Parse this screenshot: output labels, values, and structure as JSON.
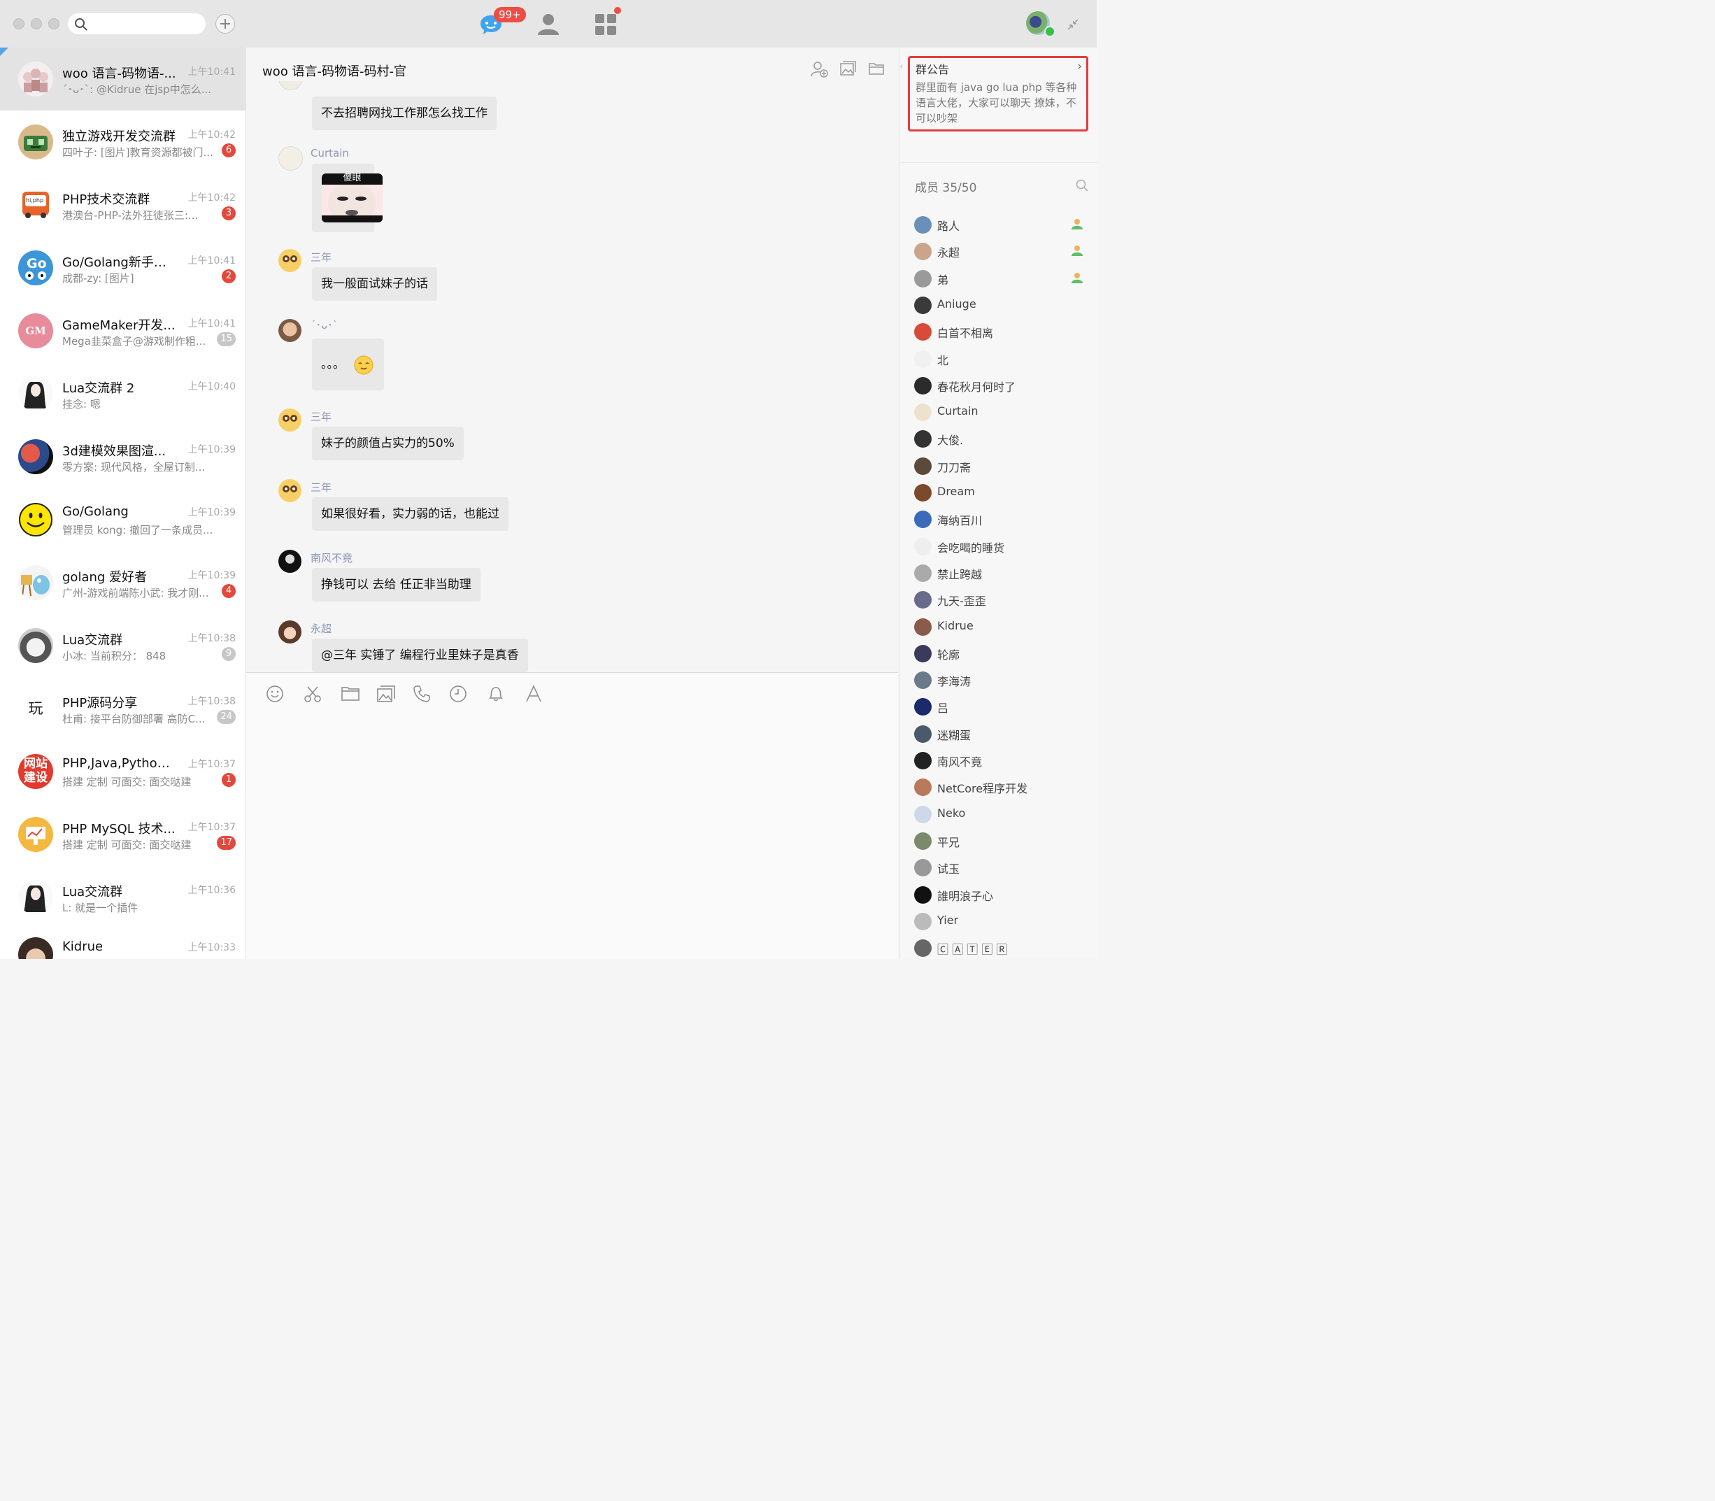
{
  "nav": {
    "messages_badge": "99+"
  },
  "conversations": [
    {
      "title": "woo 语言-码物语-...",
      "time": "上午10:41",
      "preview": "´･ᴗ･`: @Kidrue 在jsp中怎么...",
      "badge": ""
    },
    {
      "title": "独立游戏开发交流群",
      "time": "上午10:42",
      "preview": "四叶子: [图片]教育资源都被门...",
      "badge": "6"
    },
    {
      "title": "PHP技术交流群",
      "time": "上午10:42",
      "preview": "港澳台-PHP-法外狂徒张三:...",
      "badge": "3"
    },
    {
      "title": "Go/Golang新手技...",
      "time": "上午10:41",
      "preview": "成都-zy: [图片]",
      "badge": "2"
    },
    {
      "title": "GameMaker开发...",
      "time": "上午10:41",
      "preview": "Mega韭菜盒子@游戏制作粗...",
      "badge": "15"
    },
    {
      "title": "Lua交流群 2",
      "time": "上午10:40",
      "preview": "挂念: 嗯",
      "badge": ""
    },
    {
      "title": "3d建模效果图渲...",
      "time": "上午10:39",
      "preview": "零方案: 现代风格，全屋订制...",
      "badge": ""
    },
    {
      "title": "Go/Golang",
      "time": "上午10:39",
      "preview": "管理员 kong: 撤回了一条成员...",
      "badge": ""
    },
    {
      "title": "golang 爱好者",
      "time": "上午10:39",
      "preview": "广州-游戏前端陈小武: 我才刚...",
      "badge": "4"
    },
    {
      "title": "Lua交流群",
      "time": "上午10:38",
      "preview": "小冰: 当前积分： 848",
      "badge": "9"
    },
    {
      "title": "PHP源码分享",
      "time": "上午10:38",
      "preview": "杜甫: 接平台防御部署 高防C...",
      "badge": "24"
    },
    {
      "title": "PHP,Java,Python,...",
      "time": "上午10:37",
      "preview": "搭建 定制 可面交: 面交哒建",
      "badge": "1"
    },
    {
      "title": "PHP MySQL 技术...",
      "time": "上午10:37",
      "preview": "搭建 定制 可面交: 面交哒建",
      "badge": "17"
    },
    {
      "title": "Lua交流群",
      "time": "上午10:36",
      "preview": "L: 就是一个插件",
      "badge": ""
    },
    {
      "title": "Kidrue",
      "time": "上午10:33",
      "preview": "",
      "badge": ""
    }
  ],
  "avatar_text": {
    "gamemaker": "GM",
    "php_src": "玩",
    "website_line1": "网站",
    "website_line2": "建设",
    "hiphp": "hi,php",
    "go": "Go"
  },
  "chat": {
    "title": "woo 语言-码物语-码村-官",
    "messages": [
      {
        "name": "Curtain",
        "text": "不去招聘网找工作那怎么找工作"
      },
      {
        "name": "Curtain",
        "text": "[image]",
        "sticker_text": "傻眼"
      },
      {
        "name": "三年",
        "text": "我一般面试妹子的话"
      },
      {
        "name": "´･ᴗ･`",
        "text": "。。。"
      },
      {
        "name": "三年",
        "text": "妹子的颜值占实力的50%"
      },
      {
        "name": "三年",
        "text": "如果很好看，实力弱的话，也能过"
      },
      {
        "name": "南风不竟",
        "text": "挣钱可以 去给 任正非当助理"
      },
      {
        "name": "永超",
        "text": "@三年 实锤了 编程行业里妹子是真香"
      }
    ]
  },
  "notice": {
    "title": "群公告",
    "text": "群里面有 java  go lua php 等各种语言大佬，大家可以聊天 撩妹，不可以吵架"
  },
  "members": {
    "title": "成员 35/50",
    "list": [
      "路人",
      "永超",
      "弟",
      "Aniuge",
      "白首不相离",
      "北",
      "春花秋月何时了",
      "Curtain",
      "大俊.",
      "刀刀斋",
      "Dream",
      "海纳百川",
      "会吃喝的睡货",
      "禁止跨越",
      "九天-歪歪",
      "Kidrue",
      "轮廓",
      "李海涛",
      "吕",
      "迷糊蛋",
      "南风不竟",
      "NetCore程序开发",
      "Neko",
      "平兄",
      "试玉",
      "誰明浪子心",
      "Yier",
      "🄲 🄰 🅃 🄴 🅁"
    ]
  },
  "colors": {
    "badge": "#e3483d",
    "notice_border": "#e23d3d",
    "name": "#8c97b8"
  }
}
